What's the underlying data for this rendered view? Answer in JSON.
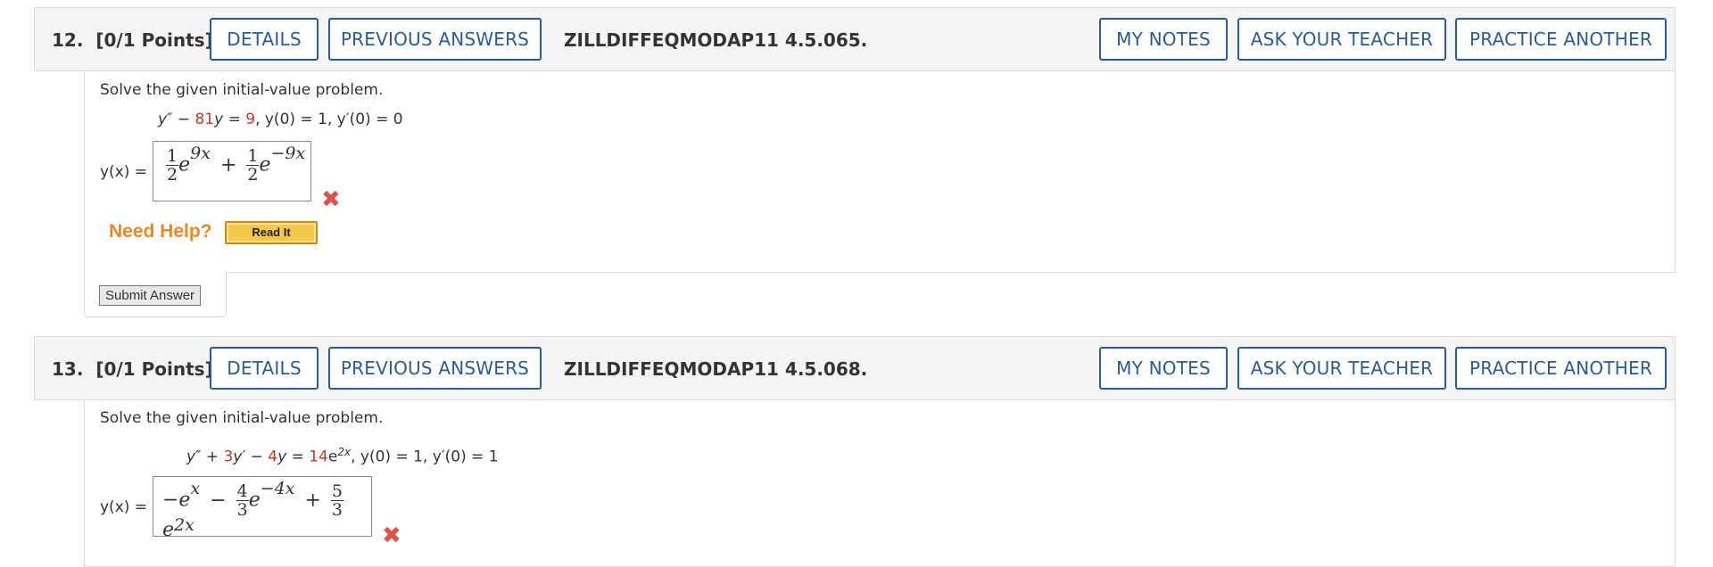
{
  "questions": [
    {
      "number_label": "12.",
      "points_label": "[0/1 Points]",
      "details_label": "DETAILS",
      "previous_answers_label": "PREVIOUS ANSWERS",
      "code": "ZILLDIFFEQMODAP11 4.5.065.",
      "my_notes_label": "MY NOTES",
      "ask_teacher_label": "ASK YOUR TEACHER",
      "practice_another_label": "PRACTICE ANOTHER",
      "prompt": "Solve the given initial-value problem.",
      "equation": {
        "p1": "y″ − ",
        "c1": "81",
        "p2": "y = ",
        "c2": "9",
        "p3": ",    y(0) = 1, y′(0) = 0"
      },
      "answer_label": "y(x) =",
      "answer": {
        "t1_num": "1",
        "t1_den": "2",
        "t1_exp": "9x",
        "op": "+",
        "t2_num": "1",
        "t2_den": "2",
        "t2_exp": "−9x"
      },
      "status": "incorrect",
      "need_help_label": "Need Help?",
      "read_it_label": "Read It",
      "submit_label": "Submit Answer"
    },
    {
      "number_label": "13.",
      "points_label": "[0/1 Points]",
      "details_label": "DETAILS",
      "previous_answers_label": "PREVIOUS ANSWERS",
      "code": "ZILLDIFFEQMODAP11 4.5.068.",
      "my_notes_label": "MY NOTES",
      "ask_teacher_label": "ASK YOUR TEACHER",
      "practice_another_label": "PRACTICE ANOTHER",
      "prompt": "Solve the given initial-value problem.",
      "equation": {
        "p1": "y″ + ",
        "c1": "3",
        "p2": "y′ − ",
        "c2": "4",
        "p3": "y = ",
        "c3": "14",
        "p4": "e",
        "exp": "2x",
        "p5": ",    y(0) = 1, y′(0) = 1"
      },
      "answer_label": "y(x) =",
      "answer": {
        "lead": "−e",
        "t0_exp": "x",
        "op1": "−",
        "t1_num": "4",
        "t1_den": "3",
        "t1_exp": "−4x",
        "op2": "+",
        "t2_num": "5",
        "t2_den": "3",
        "t2_exp": "2x"
      },
      "status": "incorrect"
    }
  ],
  "colors": {
    "accent": "#2c5c8f",
    "highlight_number": "#c0392b",
    "incorrect": "#d9534f",
    "help": "#e5892b"
  },
  "icons": {
    "incorrect": "x-mark-icon"
  }
}
